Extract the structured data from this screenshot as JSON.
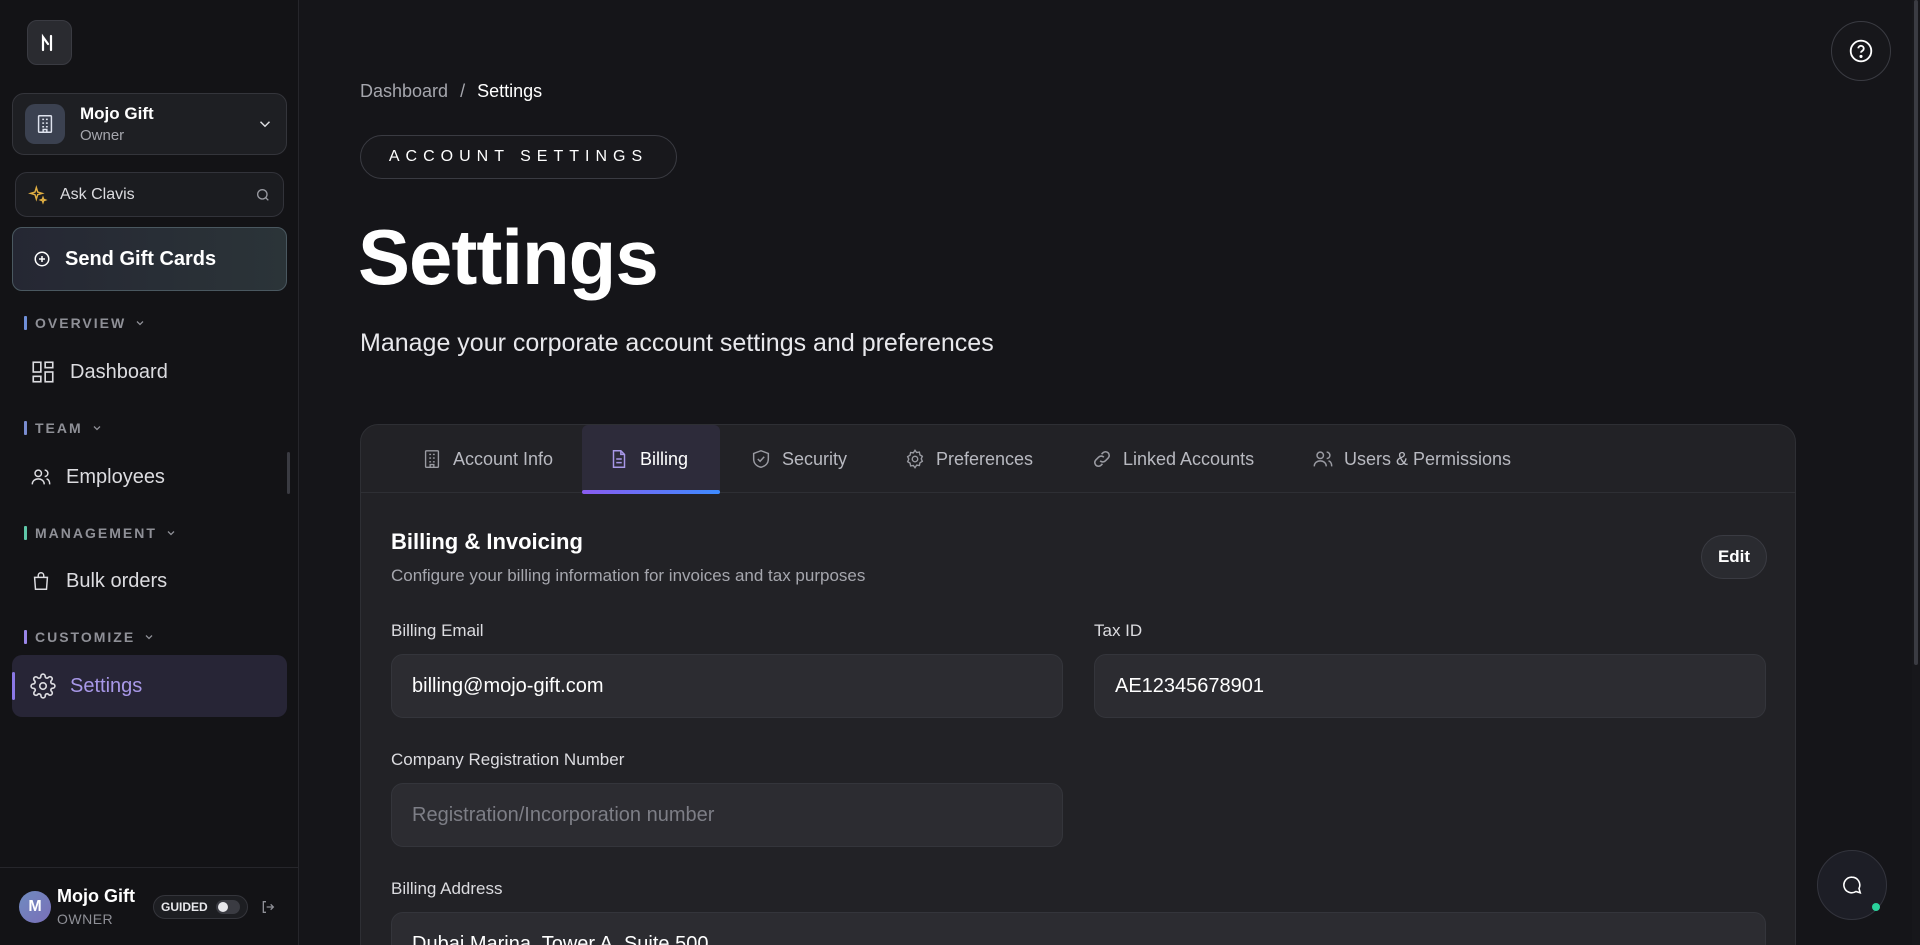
{
  "sidebar": {
    "org": {
      "name": "Mojo Gift",
      "role": "Owner"
    },
    "ask": {
      "label": "Ask Clavis"
    },
    "send_button": "Send Gift Cards",
    "sections": [
      {
        "label": "OVERVIEW",
        "color": "#6f8fd8",
        "item": "Dashboard"
      },
      {
        "label": "TEAM",
        "color": "#7a8cd0",
        "item": "Employees"
      },
      {
        "label": "MANAGEMENT",
        "color": "#5fc7a8",
        "item": "Bulk orders"
      },
      {
        "label": "CUSTOMIZE",
        "color": "#9a86e8",
        "item": "Settings"
      }
    ],
    "user": {
      "name": "Mojo Gift",
      "role": "OWNER",
      "avatar": "M",
      "guided": "GUIDED"
    }
  },
  "breadcrumb": {
    "parent": "Dashboard",
    "separator": "/",
    "current": "Settings"
  },
  "header": {
    "pill": "ACCOUNT SETTINGS",
    "title": "Settings",
    "subtitle": "Manage your corporate account settings and preferences"
  },
  "tabs": [
    {
      "label": "Account Info",
      "icon": "building-icon"
    },
    {
      "label": "Billing",
      "icon": "document-icon",
      "active": true
    },
    {
      "label": "Security",
      "icon": "shield-check-icon"
    },
    {
      "label": "Preferences",
      "icon": "gear-icon"
    },
    {
      "label": "Linked Accounts",
      "icon": "link-icon"
    },
    {
      "label": "Users & Permissions",
      "icon": "users-icon"
    }
  ],
  "billing": {
    "title": "Billing & Invoicing",
    "description": "Configure your billing information for invoices and tax purposes",
    "edit_label": "Edit",
    "fields": {
      "email": {
        "label": "Billing Email",
        "value": "billing@mojo-gift.com"
      },
      "tax": {
        "label": "Tax ID",
        "value": "AE12345678901"
      },
      "registration": {
        "label": "Company Registration Number",
        "placeholder": "Registration/Incorporation number"
      },
      "address": {
        "label": "Billing Address",
        "value": "Dubai Marina, Tower A, Suite 500"
      }
    }
  },
  "colors": {
    "accent": "#8b78e6",
    "online": "#2ad29c"
  }
}
